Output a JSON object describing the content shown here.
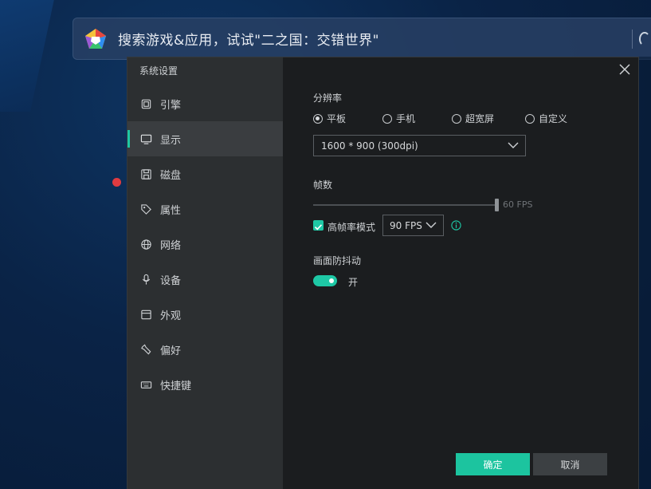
{
  "search": {
    "text": "搜索游戏&应用，试试\"二之国：交错世界\""
  },
  "dialog": {
    "title": "系统设置",
    "nav": [
      {
        "label": "引擎",
        "icon": "chip-icon"
      },
      {
        "label": "显示",
        "icon": "monitor-icon",
        "active": true
      },
      {
        "label": "磁盘",
        "icon": "disk-icon"
      },
      {
        "label": "属性",
        "icon": "tag-icon"
      },
      {
        "label": "网络",
        "icon": "globe-icon"
      },
      {
        "label": "设备",
        "icon": "microphone-icon"
      },
      {
        "label": "外观",
        "icon": "window-icon"
      },
      {
        "label": "偏好",
        "icon": "wrench-icon"
      },
      {
        "label": "快捷键",
        "icon": "keyboard-icon"
      }
    ]
  },
  "display": {
    "resolution_label": "分辨率",
    "resolution_options": [
      {
        "label": "平板",
        "checked": true
      },
      {
        "label": "手机",
        "checked": false
      },
      {
        "label": "超宽屏",
        "checked": false
      },
      {
        "label": "自定义",
        "checked": false
      }
    ],
    "resolution_value": "1600 * 900 (300dpi)",
    "fps_label": "帧数",
    "fps_slider_value": "60 FPS",
    "high_fps_label": "高帧率模式",
    "high_fps_checked": true,
    "high_fps_value": "90 FPS",
    "anti_shake_label": "画面防抖动",
    "anti_shake_state": "开",
    "anti_shake_on": true
  },
  "buttons": {
    "confirm": "确定",
    "cancel": "取消"
  },
  "colors": {
    "accent": "#1ec8a5",
    "dialog_bg": "#1b1d1f",
    "sidebar_bg": "#2c2f31"
  }
}
